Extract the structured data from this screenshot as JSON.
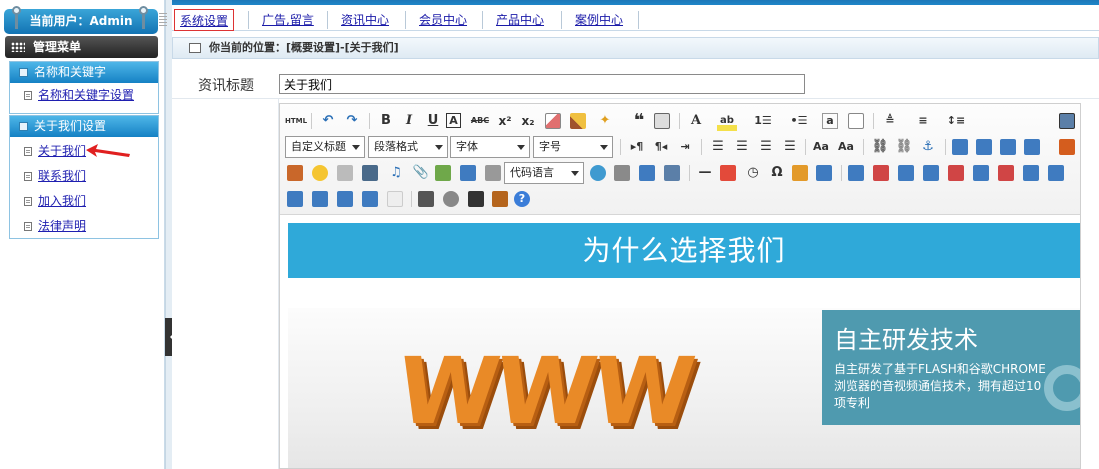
{
  "app": {
    "current_user": "当前用户：Admin"
  },
  "menu": {
    "title": "管理菜单",
    "groups": [
      {
        "title": "名称和关键字",
        "items": [
          "名称和关键字设置"
        ]
      },
      {
        "title": "关于我们设置",
        "items": [
          "关于我们",
          "联系我们",
          "加入我们",
          "法律声明"
        ]
      }
    ]
  },
  "nav": {
    "tabs": [
      "系统设置",
      "广告,留言",
      "资讯中心",
      "会员中心",
      "产品中心",
      "案例中心"
    ],
    "active": "系统设置"
  },
  "breadcrumb": "你当前的位置：[概要设置]-[关于我们]",
  "form": {
    "title_label": "资讯标题",
    "title_value": "关于我们"
  },
  "toolbar": {
    "selects": {
      "custom_title": "自定义标题",
      "paragraph": "段落格式",
      "font": "字体",
      "size": "字号",
      "code": "代码语言"
    },
    "html_label": "HTML"
  },
  "content": {
    "banner": "为什么选择我们",
    "www": "WWW",
    "tech_title": "自主研发技术",
    "tech_text": "自主研发了基于FLASH和谷歌CHROME浏览器的音视频通信技术，拥有超过10项专利"
  },
  "colors": {
    "accent": "#2fa9d9",
    "panel": "#1581c4",
    "tech_box": "#4f9aaf",
    "www": "#e98a27"
  }
}
